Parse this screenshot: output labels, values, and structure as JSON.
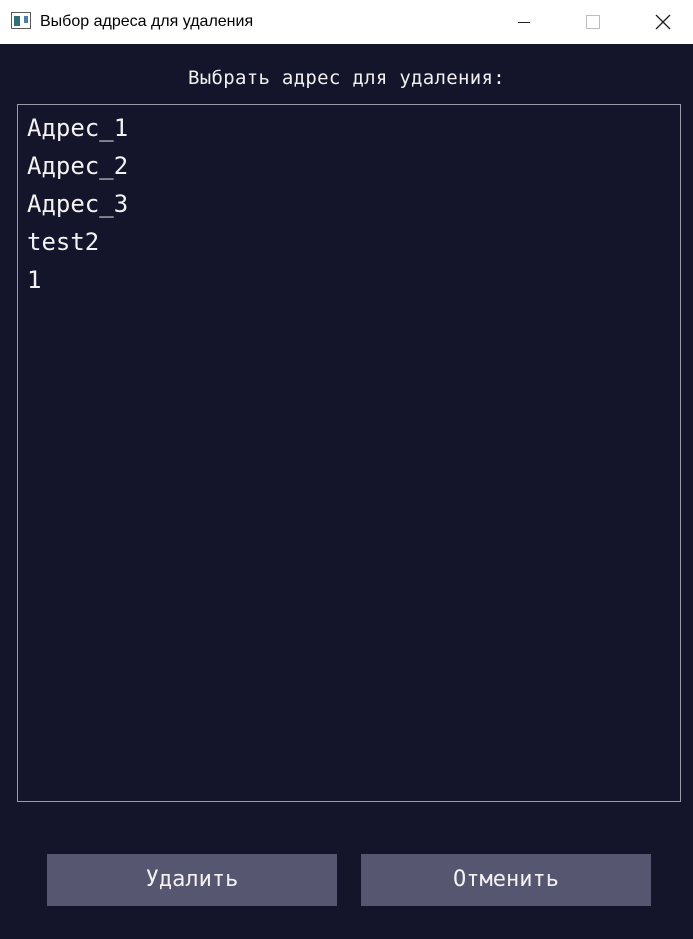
{
  "window": {
    "title": "Выбор адреса для удаления",
    "controls": [
      "minimize",
      "maximize",
      "close"
    ]
  },
  "heading": "Выбрать адрес для удаления:",
  "address_list": {
    "items": [
      "Адрес_1",
      "Адрес_2",
      "Адрес_3",
      "test2",
      "1"
    ]
  },
  "buttons": {
    "delete_label": "Удалить",
    "cancel_label": "Отменить"
  },
  "colors": {
    "background": "#14152a",
    "button": "#565670",
    "text": "#f2f2f2",
    "list_border": "#9a9aa8"
  }
}
